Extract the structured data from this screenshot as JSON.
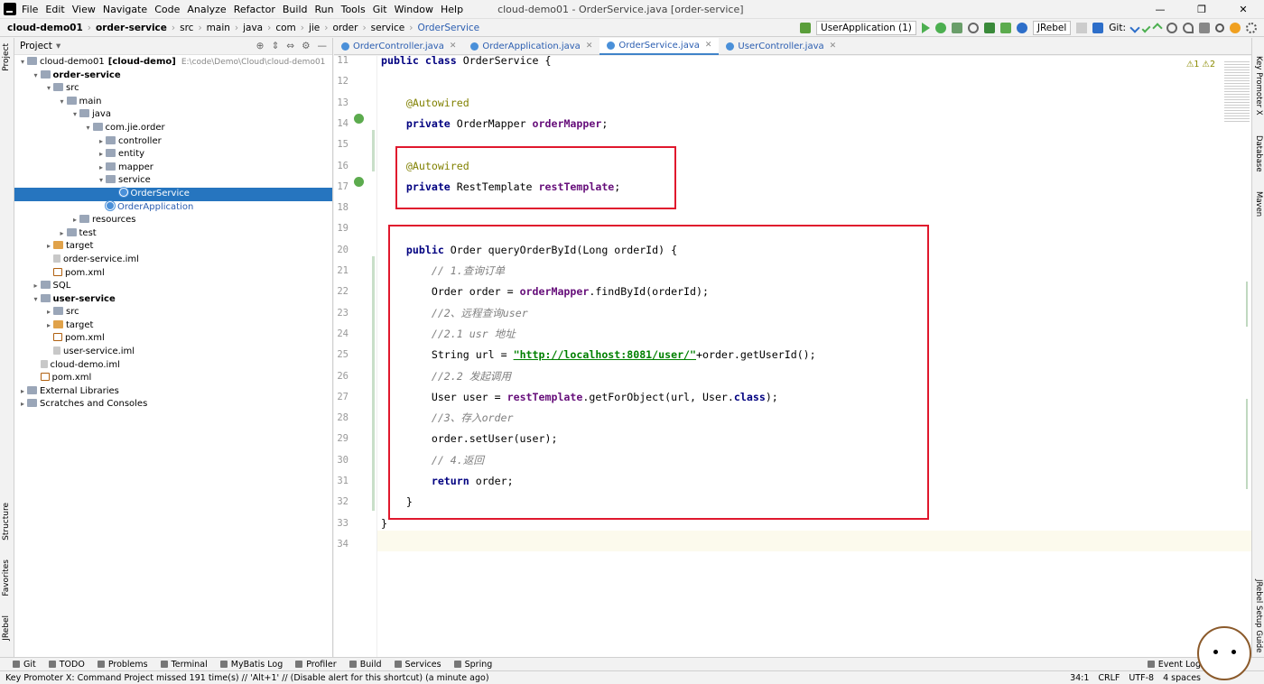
{
  "window": {
    "title": "cloud-demo01 - OrderService.java [order-service]",
    "controls": [
      "—",
      "❐",
      "✕"
    ]
  },
  "menu": [
    "File",
    "Edit",
    "View",
    "Navigate",
    "Code",
    "Analyze",
    "Refactor",
    "Build",
    "Run",
    "Tools",
    "Git",
    "Window",
    "Help"
  ],
  "breadcrumb": [
    "cloud-demo01",
    "order-service",
    "src",
    "main",
    "java",
    "com",
    "jie",
    "order",
    "service",
    "OrderService"
  ],
  "toolbar": {
    "run_config": "UserApplication (1)",
    "jrebel": "JRebel",
    "git_label": "Git:"
  },
  "project": {
    "header": "Project",
    "tree": [
      {
        "label": "cloud-demo01",
        "extra": "[cloud-demo]",
        "path": "E:\\code\\Demo\\Cloud\\cloud-demo01",
        "depth": 0,
        "arrow": "▾",
        "icon": "folder"
      },
      {
        "label": "order-service",
        "depth": 1,
        "arrow": "▾",
        "icon": "folder",
        "bold": true
      },
      {
        "label": "src",
        "depth": 2,
        "arrow": "▾",
        "icon": "folder"
      },
      {
        "label": "main",
        "depth": 3,
        "arrow": "▾",
        "icon": "folder"
      },
      {
        "label": "java",
        "depth": 4,
        "arrow": "▾",
        "icon": "folder"
      },
      {
        "label": "com.jie.order",
        "depth": 5,
        "arrow": "▾",
        "icon": "folder"
      },
      {
        "label": "controller",
        "depth": 6,
        "arrow": "▸",
        "icon": "folder"
      },
      {
        "label": "entity",
        "depth": 6,
        "arrow": "▸",
        "icon": "folder"
      },
      {
        "label": "mapper",
        "depth": 6,
        "arrow": "▸",
        "icon": "folder"
      },
      {
        "label": "service",
        "depth": 6,
        "arrow": "▾",
        "icon": "folder"
      },
      {
        "label": "OrderService",
        "depth": 7,
        "arrow": "",
        "icon": "class",
        "selected": true
      },
      {
        "label": "OrderApplication",
        "depth": 6,
        "arrow": "",
        "icon": "class"
      },
      {
        "label": "resources",
        "depth": 4,
        "arrow": "▸",
        "icon": "folder"
      },
      {
        "label": "test",
        "depth": 3,
        "arrow": "▸",
        "icon": "folder"
      },
      {
        "label": "target",
        "depth": 2,
        "arrow": "▸",
        "icon": "ofolder"
      },
      {
        "label": "order-service.iml",
        "depth": 2,
        "arrow": "",
        "icon": "file"
      },
      {
        "label": "pom.xml",
        "depth": 2,
        "arrow": "",
        "icon": "mfile"
      },
      {
        "label": "SQL",
        "depth": 1,
        "arrow": "▸",
        "icon": "folder"
      },
      {
        "label": "user-service",
        "depth": 1,
        "arrow": "▾",
        "icon": "folder",
        "bold": true
      },
      {
        "label": "src",
        "depth": 2,
        "arrow": "▸",
        "icon": "folder"
      },
      {
        "label": "target",
        "depth": 2,
        "arrow": "▸",
        "icon": "ofolder"
      },
      {
        "label": "pom.xml",
        "depth": 2,
        "arrow": "",
        "icon": "mfile"
      },
      {
        "label": "user-service.iml",
        "depth": 2,
        "arrow": "",
        "icon": "file"
      },
      {
        "label": "cloud-demo.iml",
        "depth": 1,
        "arrow": "",
        "icon": "file"
      },
      {
        "label": "pom.xml",
        "depth": 1,
        "arrow": "",
        "icon": "mfile"
      },
      {
        "label": "External Libraries",
        "depth": 0,
        "arrow": "▸",
        "icon": "folder"
      },
      {
        "label": "Scratches and Consoles",
        "depth": 0,
        "arrow": "▸",
        "icon": "folder"
      }
    ]
  },
  "tabs": [
    {
      "label": "OrderController.java"
    },
    {
      "label": "OrderApplication.java"
    },
    {
      "label": "OrderService.java",
      "active": true
    },
    {
      "label": "UserController.java"
    }
  ],
  "editor": {
    "warnings": "⚠1  ⚠2",
    "lines": [
      {
        "n": "11",
        "html": "<span class='kw'>public class</span> OrderService {"
      },
      {
        "n": "12",
        "html": ""
      },
      {
        "n": "13",
        "html": "    <span class='an'>@Autowired</span>"
      },
      {
        "n": "14",
        "html": "    <span class='kw'>private</span> OrderMapper <span class='fld'>orderMapper</span>;"
      },
      {
        "n": "15",
        "html": ""
      },
      {
        "n": "16",
        "html": "    <span class='an'>@Autowired</span>"
      },
      {
        "n": "17",
        "html": "    <span class='kw'>private</span> RestTemplate <span class='fld'>restTemplate</span>;"
      },
      {
        "n": "18",
        "html": ""
      },
      {
        "n": "19",
        "html": ""
      },
      {
        "n": "20",
        "html": "    <span class='kw'>public</span> Order queryOrderById(Long orderId) {"
      },
      {
        "n": "21",
        "html": "        <span class='cm'>// 1.查询订单</span>"
      },
      {
        "n": "22",
        "html": "        Order order = <span class='fld'>orderMapper</span>.findById(orderId);"
      },
      {
        "n": "23",
        "html": "        <span class='cm'>//2、远程查询user</span>"
      },
      {
        "n": "24",
        "html": "        <span class='cm'>//2.1 usr 地址</span>"
      },
      {
        "n": "25",
        "html": "        String url = <span class='str'>\"http://localhost:8081/user/\"</span>+order.getUserId();"
      },
      {
        "n": "26",
        "html": "        <span class='cm'>//2.2 发起调用</span>"
      },
      {
        "n": "27",
        "html": "        User user = <span class='fld'>restTemplate</span>.getForObject(url, User.<span class='kw'>class</span>);"
      },
      {
        "n": "28",
        "html": "        <span class='cm'>//3、存入order</span>"
      },
      {
        "n": "29",
        "html": "        order.setUser(user);"
      },
      {
        "n": "30",
        "html": "        <span class='cm'>// 4.返回</span>"
      },
      {
        "n": "31",
        "html": "        <span class='kw'>return</span> order;"
      },
      {
        "n": "32",
        "html": "    }"
      },
      {
        "n": "33",
        "html": "}"
      },
      {
        "n": "34",
        "html": ""
      }
    ]
  },
  "left_tabs": [
    "Project",
    "Structure",
    "Favorites",
    "JRebel"
  ],
  "right_tabs": [
    "Key Promoter X",
    "Database",
    "Maven",
    "JRebel Setup Guide"
  ],
  "bottom_tools": [
    "Git",
    "TODO",
    "Problems",
    "Terminal",
    "MyBatis Log",
    "Profiler",
    "Build",
    "Services",
    "Spring",
    "Event Log"
  ],
  "status": {
    "message": "Key Promoter X: Command Project missed 191 time(s) // 'Alt+1' // (Disable alert for this shortcut) (a minute ago)",
    "position": "34:1",
    "line_sep": "CRLF",
    "encoding": "UTF-8",
    "indent": "4 spaces"
  }
}
